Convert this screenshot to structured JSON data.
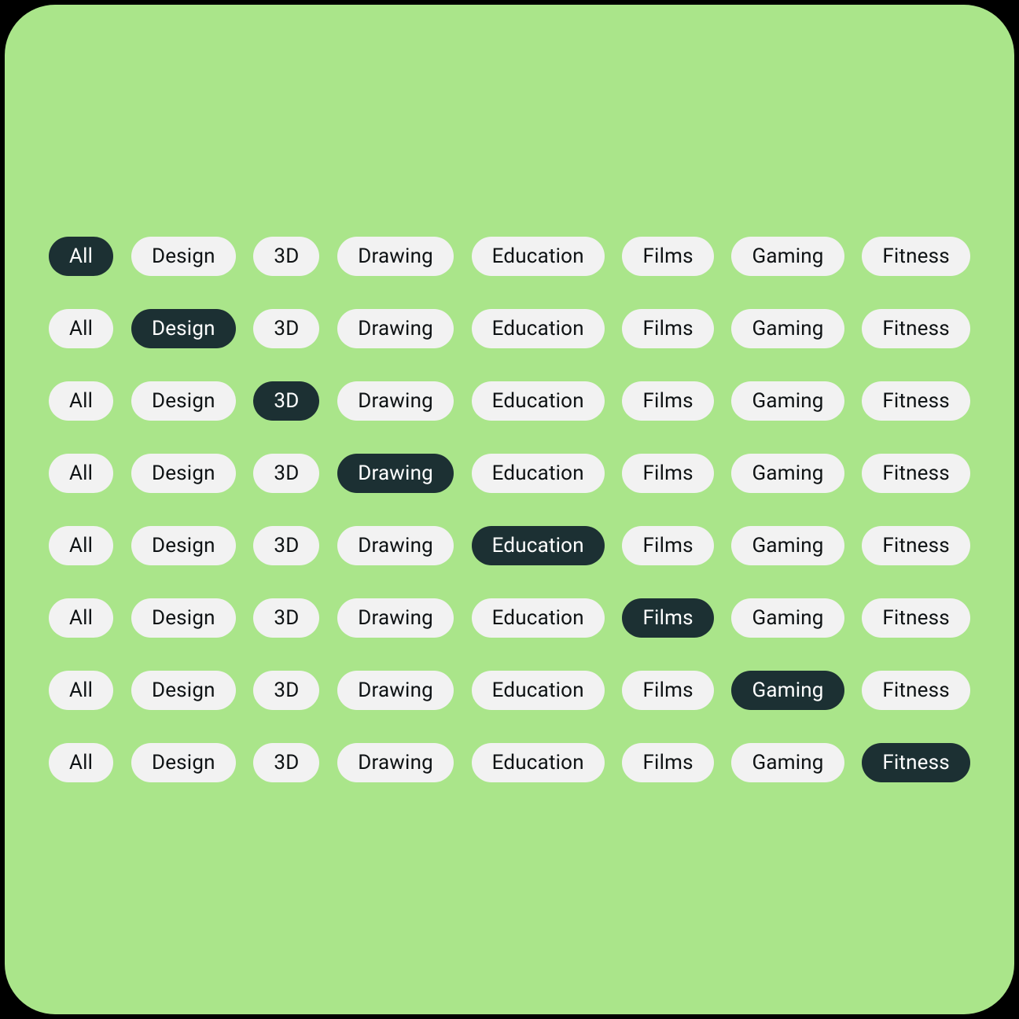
{
  "categories": [
    "All",
    "Design",
    "3D",
    "Drawing",
    "Education",
    "Films",
    "Gaming",
    "Fitness"
  ],
  "rows": [
    {
      "active_index": 0
    },
    {
      "active_index": 1
    },
    {
      "active_index": 2
    },
    {
      "active_index": 3
    },
    {
      "active_index": 4
    },
    {
      "active_index": 5
    },
    {
      "active_index": 6
    },
    {
      "active_index": 7
    }
  ],
  "colors": {
    "card_bg": "#aae58a",
    "pill_active_bg": "#1c3033",
    "pill_active_fg": "#ffffff",
    "pill_inactive_bg": "#f2f2f2",
    "pill_inactive_fg": "#0e1214"
  }
}
